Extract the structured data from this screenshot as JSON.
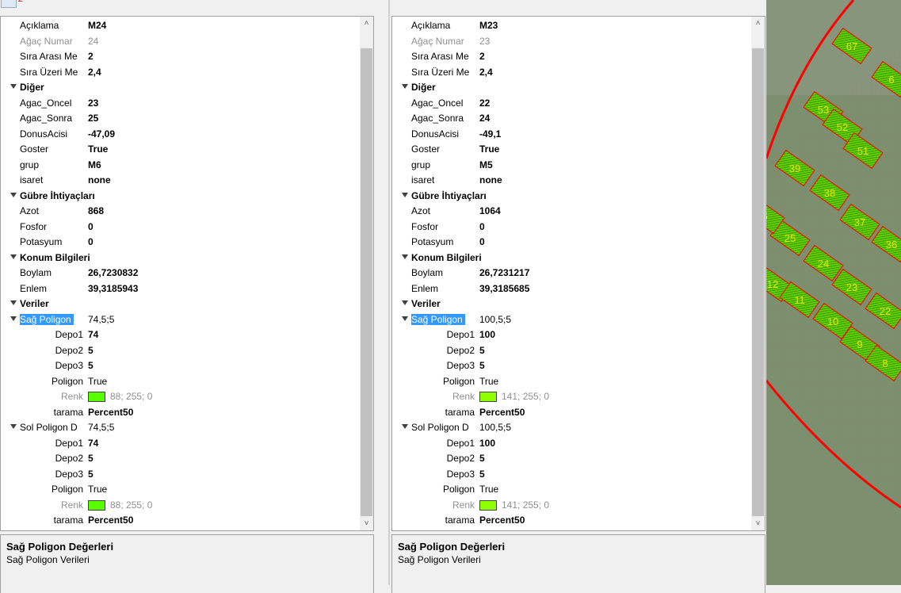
{
  "toolbar": {
    "sort_label": "Z"
  },
  "panels": [
    {
      "rows": [
        {
          "label": "Açıklama",
          "value": "M24",
          "bold": true
        },
        {
          "label": "Ağaç Numar",
          "value": "24",
          "gray": true
        },
        {
          "label": "Sıra Arası Me",
          "value": "2",
          "bold": true
        },
        {
          "label": "Sıra Üzeri Me",
          "value": "2,4",
          "bold": true
        },
        {
          "cat": "Diğer"
        },
        {
          "label": "Agac_Oncel",
          "value": "23",
          "bold": true
        },
        {
          "label": "Agac_Sonra",
          "value": "25",
          "bold": true
        },
        {
          "label": "DonusAcisi",
          "value": "-47,09",
          "bold": true
        },
        {
          "label": "Goster",
          "value": "True",
          "bold": true
        },
        {
          "label": "grup",
          "value": "M6",
          "bold": true
        },
        {
          "label": "isaret",
          "value": "none",
          "bold": true
        },
        {
          "cat": "Gübre İhtiyaçları"
        },
        {
          "label": "Azot",
          "value": "868",
          "bold": true
        },
        {
          "label": "Fosfor",
          "value": "0",
          "bold": true
        },
        {
          "label": "Potasyum",
          "value": "0",
          "bold": true
        },
        {
          "cat": "Konum Bilgileri"
        },
        {
          "label": "Boylam",
          "value": "26,7230832",
          "bold": true
        },
        {
          "label": "Enlem",
          "value": "39,3185943",
          "bold": true
        },
        {
          "cat": "Veriler"
        },
        {
          "label": "Sağ Poligon",
          "value": "74,5;5",
          "sub": true,
          "selected": true
        },
        {
          "label": "Depo1",
          "value": "74",
          "bold": true,
          "child": true
        },
        {
          "label": "Depo2",
          "value": "5",
          "bold": true,
          "child": true
        },
        {
          "label": "Depo3",
          "value": "5",
          "bold": true,
          "child": true
        },
        {
          "label": "Poligon",
          "value": "True",
          "child": true
        },
        {
          "label": "Renk",
          "value": "88; 255; 0",
          "child": true,
          "gray": true,
          "swatch": "#58ff00"
        },
        {
          "label": "tarama",
          "value": "Percent50",
          "bold": true,
          "child": true
        },
        {
          "label": "Sol Poligon D",
          "value": "74,5;5",
          "sub": true
        },
        {
          "label": "Depo1",
          "value": "74",
          "bold": true,
          "child": true
        },
        {
          "label": "Depo2",
          "value": "5",
          "bold": true,
          "child": true
        },
        {
          "label": "Depo3",
          "value": "5",
          "bold": true,
          "child": true
        },
        {
          "label": "Poligon",
          "value": "True",
          "child": true
        },
        {
          "label": "Renk",
          "value": "88; 255; 0",
          "child": true,
          "gray": true,
          "swatch": "#58ff00"
        },
        {
          "label": "tarama",
          "value": "Percent50",
          "bold": true,
          "child": true
        }
      ],
      "desc_title": "Sağ Poligon Değerleri",
      "desc_text": "Sağ Poligon Verileri"
    },
    {
      "rows": [
        {
          "label": "Açıklama",
          "value": "M23",
          "bold": true
        },
        {
          "label": "Ağaç Numar",
          "value": "23",
          "gray": true
        },
        {
          "label": "Sıra Arası Me",
          "value": "2",
          "bold": true
        },
        {
          "label": "Sıra Üzeri Me",
          "value": "2,4",
          "bold": true
        },
        {
          "cat": "Diğer"
        },
        {
          "label": "Agac_Oncel",
          "value": "22",
          "bold": true
        },
        {
          "label": "Agac_Sonra",
          "value": "24",
          "bold": true
        },
        {
          "label": "DonusAcisi",
          "value": "-49,1",
          "bold": true
        },
        {
          "label": "Goster",
          "value": "True",
          "bold": true
        },
        {
          "label": "grup",
          "value": "M5",
          "bold": true
        },
        {
          "label": "isaret",
          "value": "none",
          "bold": true
        },
        {
          "cat": "Gübre İhtiyaçları"
        },
        {
          "label": "Azot",
          "value": "1064",
          "bold": true
        },
        {
          "label": "Fosfor",
          "value": "0",
          "bold": true
        },
        {
          "label": "Potasyum",
          "value": "0",
          "bold": true
        },
        {
          "cat": "Konum Bilgileri"
        },
        {
          "label": "Boylam",
          "value": "26,7231217",
          "bold": true
        },
        {
          "label": "Enlem",
          "value": "39,3185685",
          "bold": true
        },
        {
          "cat": "Veriler"
        },
        {
          "label": "Sağ Poligon",
          "value": "100,5;5",
          "sub": true,
          "selected": true
        },
        {
          "label": "Depo1",
          "value": "100",
          "bold": true,
          "child": true
        },
        {
          "label": "Depo2",
          "value": "5",
          "bold": true,
          "child": true
        },
        {
          "label": "Depo3",
          "value": "5",
          "bold": true,
          "child": true
        },
        {
          "label": "Poligon",
          "value": "True",
          "child": true
        },
        {
          "label": "Renk",
          "value": "141; 255; 0",
          "child": true,
          "gray": true,
          "swatch": "#8dff00"
        },
        {
          "label": "tarama",
          "value": "Percent50",
          "bold": true,
          "child": true
        },
        {
          "label": "Sol Poligon D",
          "value": "100,5;5",
          "sub": true
        },
        {
          "label": "Depo1",
          "value": "100",
          "bold": true,
          "child": true
        },
        {
          "label": "Depo2",
          "value": "5",
          "bold": true,
          "child": true
        },
        {
          "label": "Depo3",
          "value": "5",
          "bold": true,
          "child": true
        },
        {
          "label": "Poligon",
          "value": "True",
          "child": true
        },
        {
          "label": "Renk",
          "value": "141; 255; 0",
          "child": true,
          "gray": true,
          "swatch": "#8dff00"
        },
        {
          "label": "tarama",
          "value": "Percent50",
          "bold": true,
          "child": true
        }
      ],
      "desc_title": "Sağ Poligon Değerleri",
      "desc_text": "Sağ Poligon Verileri"
    }
  ],
  "map": {
    "tree_labels": [
      "67",
      "6",
      "53",
      "52",
      "51",
      "39",
      "38",
      "37",
      "36",
      "25",
      "24",
      "23",
      "22",
      "12",
      "11",
      "10",
      "9",
      "8",
      "6"
    ],
    "colors": {
      "parcel": "#58d000",
      "border": "#ff0000",
      "aerial": "#7c8f6e"
    }
  }
}
